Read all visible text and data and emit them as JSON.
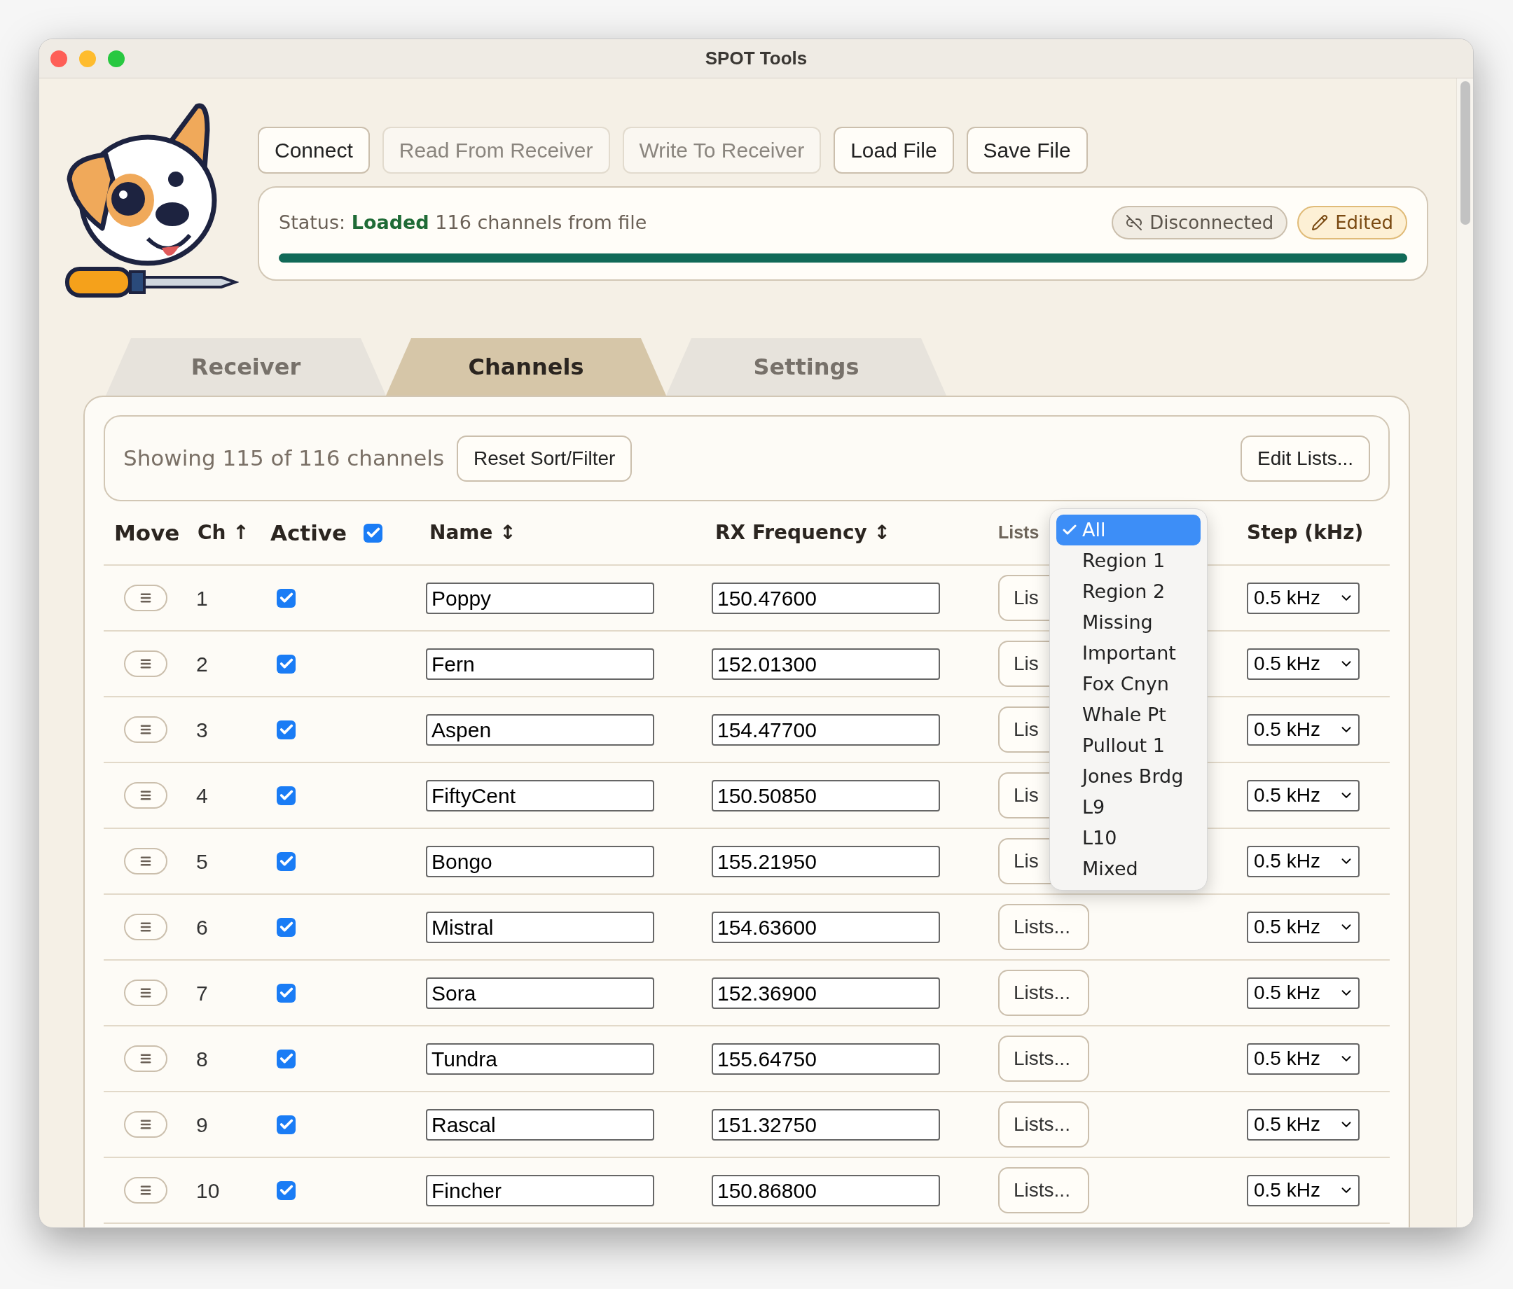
{
  "window": {
    "title": "SPOT Tools"
  },
  "toolbar": {
    "buttons": [
      {
        "label": "Connect",
        "disabled": false
      },
      {
        "label": "Read From Receiver",
        "disabled": true
      },
      {
        "label": "Write To Receiver",
        "disabled": true
      },
      {
        "label": "Load File",
        "disabled": false
      },
      {
        "label": "Save File",
        "disabled": false
      }
    ]
  },
  "status": {
    "label": "Status:",
    "state": "Loaded",
    "detail": "116 channels from file",
    "level": 1,
    "badges": [
      {
        "kind": "connection",
        "label": "Disconnected"
      },
      {
        "kind": "edited",
        "label": "Edited"
      }
    ]
  },
  "tabs": [
    {
      "label": "Receiver",
      "selected": false
    },
    {
      "label": "Channels",
      "selected": true
    },
    {
      "label": "Settings",
      "selected": false
    }
  ],
  "filter_bar": {
    "summary": "Showing 115 of 116 channels",
    "reset_button": "Reset Sort/Filter",
    "edit_lists_button": "Edit Lists..."
  },
  "table": {
    "columns": [
      {
        "label": "Move"
      },
      {
        "label": "Ch",
        "sort_mark": "↑"
      },
      {
        "label": "Active",
        "checked": true
      },
      {
        "label": "Name",
        "sort_mark": "↕"
      },
      {
        "label": "RX Frequency",
        "sort_mark": "↕"
      },
      {
        "label": "Lists"
      },
      {
        "label": "Step (kHz)"
      }
    ],
    "rows": [
      {
        "ch": "1",
        "active": true,
        "name": "Poppy",
        "frequency": "150.47600",
        "lists_button": "Lis",
        "step": "0.5 kHz"
      },
      {
        "ch": "2",
        "active": true,
        "name": "Fern",
        "frequency": "152.01300",
        "lists_button": "Lis",
        "step": "0.5 kHz"
      },
      {
        "ch": "3",
        "active": true,
        "name": "Aspen",
        "frequency": "154.47700",
        "lists_button": "Lis",
        "step": "0.5 kHz"
      },
      {
        "ch": "4",
        "active": true,
        "name": "FiftyCent",
        "frequency": "150.50850",
        "lists_button": "Lis",
        "step": "0.5 kHz"
      },
      {
        "ch": "5",
        "active": true,
        "name": "Bongo",
        "frequency": "155.21950",
        "lists_button": "Lis",
        "step": "0.5 kHz"
      },
      {
        "ch": "6",
        "active": true,
        "name": "Mistral",
        "frequency": "154.63600",
        "lists_button": "Lists...",
        "step": "0.5 kHz"
      },
      {
        "ch": "7",
        "active": true,
        "name": "Sora",
        "frequency": "152.36900",
        "lists_button": "Lists...",
        "step": "0.5 kHz"
      },
      {
        "ch": "8",
        "active": true,
        "name": "Tundra",
        "frequency": "155.64750",
        "lists_button": "Lists...",
        "step": "0.5 kHz"
      },
      {
        "ch": "9",
        "active": true,
        "name": "Rascal",
        "frequency": "151.32750",
        "lists_button": "Lists...",
        "step": "0.5 kHz"
      },
      {
        "ch": "10",
        "active": true,
        "name": "Fincher",
        "frequency": "150.86800",
        "lists_button": "Lists...",
        "step": "0.5 kHz"
      }
    ]
  },
  "lists_dropdown": {
    "items": [
      {
        "label": "All",
        "selected": true
      },
      {
        "label": "Region 1",
        "selected": false
      },
      {
        "label": "Region 2",
        "selected": false
      },
      {
        "label": "Missing",
        "selected": false
      },
      {
        "label": "Important",
        "selected": false
      },
      {
        "label": "Fox Cnyn",
        "selected": false
      },
      {
        "label": "Whale Pt",
        "selected": false
      },
      {
        "label": "Pullout 1",
        "selected": false
      },
      {
        "label": "Jones Brdg",
        "selected": false
      },
      {
        "label": "L9",
        "selected": false
      },
      {
        "label": "L10",
        "selected": false
      },
      {
        "label": "Mixed",
        "selected": false
      }
    ]
  }
}
